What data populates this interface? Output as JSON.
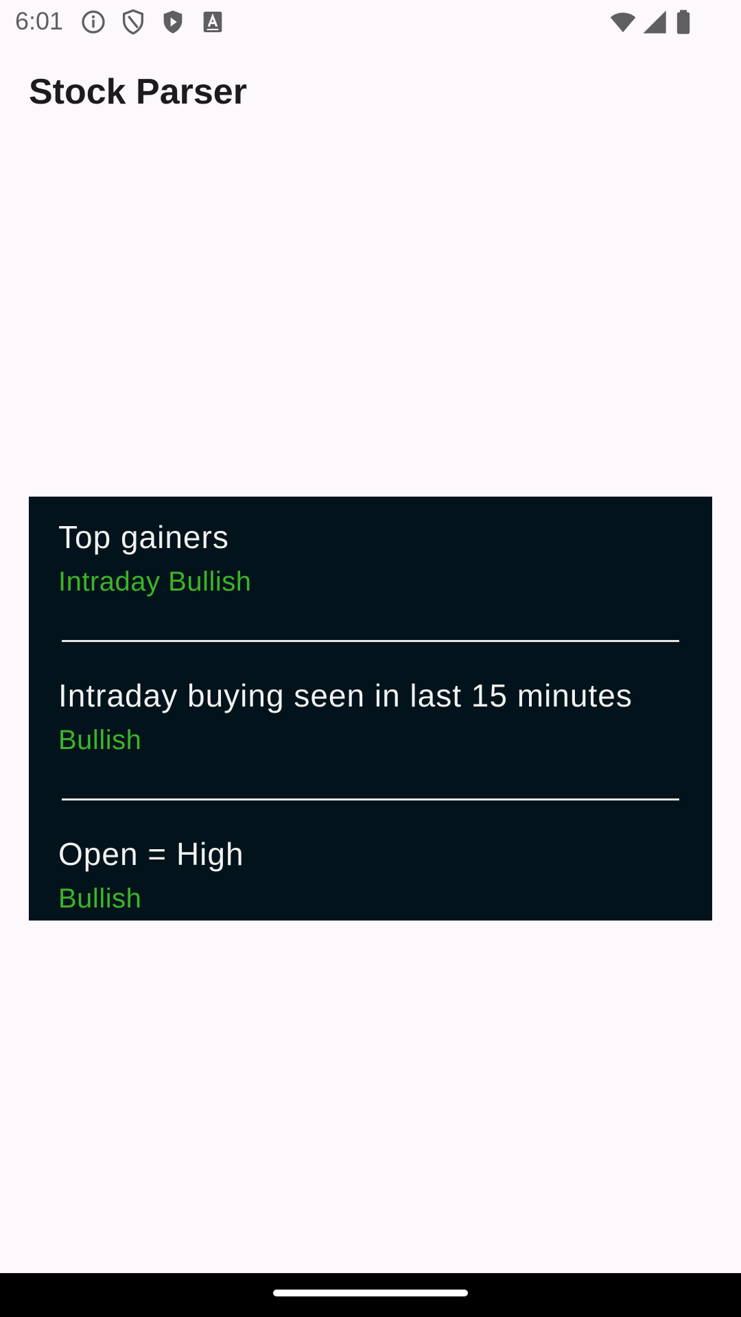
{
  "status_bar": {
    "time": "6:01",
    "left_icons": [
      "info-icon",
      "shield-icon",
      "play-shield-icon",
      "font-a-icon"
    ],
    "right_icons": [
      "wifi-icon",
      "cellular-signal-icon",
      "battery-icon"
    ]
  },
  "app_bar": {
    "title": "Stock Parser"
  },
  "card": {
    "background_color": "#03131c",
    "accent_color": "#3cb527",
    "items": [
      {
        "title": "Top gainers",
        "subtitle": "Intraday Bullish"
      },
      {
        "title": "Intraday buying seen in last 15 minutes",
        "subtitle": "Bullish"
      },
      {
        "title": "Open = High",
        "subtitle": "Bullish"
      }
    ]
  }
}
